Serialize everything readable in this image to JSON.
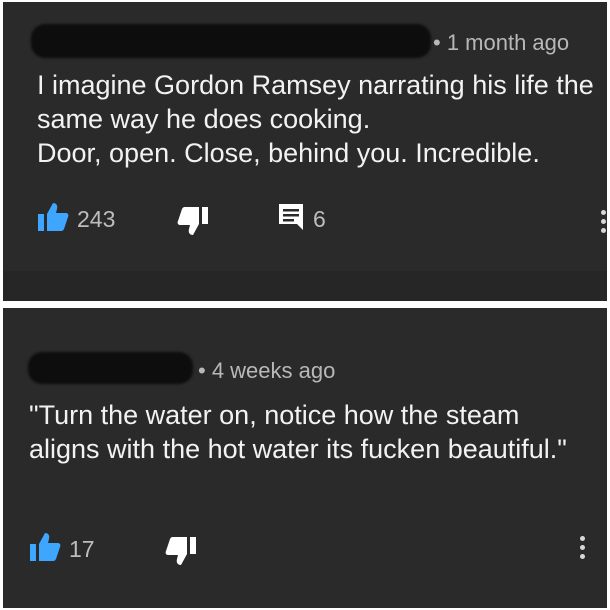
{
  "comments": [
    {
      "timestamp": "• 1 month ago",
      "text": "I imagine Gordon Ramsey narrating his life the same way he does cooking.\nDoor, open. Close, behind you. Incredible.",
      "likes": "243",
      "replies": "6",
      "icons": [
        "thumbs-up-icon",
        "thumbs-down-icon",
        "reply-icon",
        "more-vert-icon"
      ]
    },
    {
      "timestamp": "• 4 weeks ago",
      "text": "\"Turn the water on, notice how the steam aligns with the hot water its fucken beautiful.\"",
      "likes": "17",
      "icons": [
        "thumbs-up-icon",
        "thumbs-down-icon",
        "more-vert-icon"
      ]
    }
  ],
  "colors": {
    "background": "#2a2a2a",
    "liked_blue": "#3ea6ff",
    "text": "#f2f2f2",
    "meta_text": "#b8b8b8"
  }
}
